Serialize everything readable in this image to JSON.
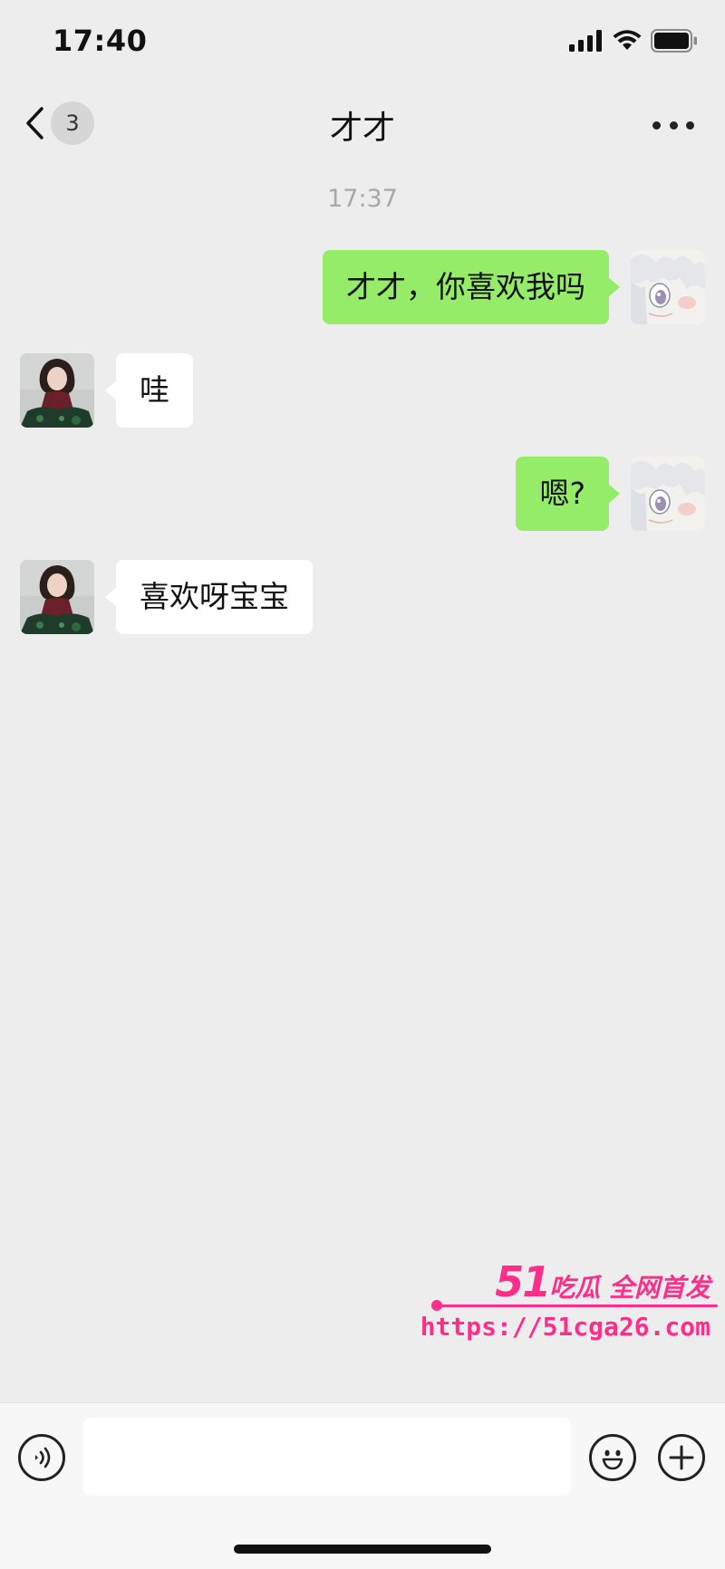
{
  "status_bar": {
    "time": "17:40",
    "icons": [
      "signal-icon",
      "wifi-icon",
      "battery-icon"
    ]
  },
  "nav": {
    "back_icon": "chevron-left-icon",
    "unread_count": "3",
    "title": "才才",
    "more_icon": "more-dots-icon"
  },
  "chat": {
    "timestamp": "17:37",
    "messages": [
      {
        "direction": "outgoing",
        "text": "才才，你喜欢我吗"
      },
      {
        "direction": "incoming",
        "text": "哇"
      },
      {
        "direction": "outgoing",
        "text": "嗯?"
      },
      {
        "direction": "incoming",
        "text": "喜欢呀宝宝"
      }
    ]
  },
  "watermark": {
    "brand_number": "51",
    "brand_text": "吃瓜 全网首发",
    "url": "https://51cga26.com",
    "color": "#ff2d8a"
  },
  "input_bar": {
    "voice_icon": "voice-icon",
    "emoji_icon": "emoji-icon",
    "plus_icon": "plus-icon",
    "input_value": ""
  },
  "colors": {
    "background": "#ededed",
    "outgoing_bubble": "#95ec69",
    "incoming_bubble": "#ffffff",
    "timestamp": "#a8a8a8"
  }
}
